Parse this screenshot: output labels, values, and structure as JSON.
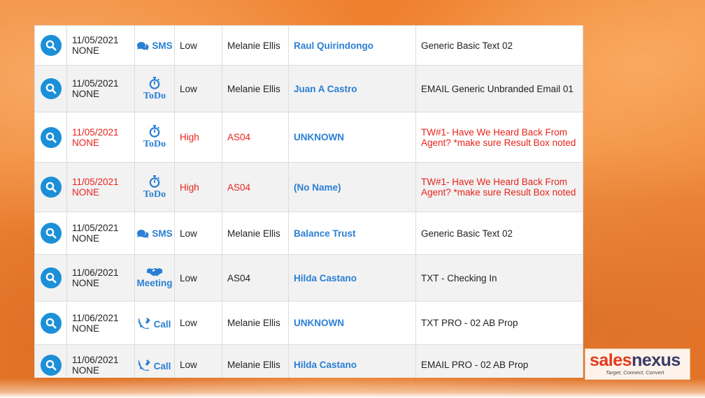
{
  "colors": {
    "accent_blue": "#2a7fd4",
    "button_blue": "#1b8fd8",
    "alert_red": "#e8231c",
    "background_orange": "#ee7f2c"
  },
  "rows": [
    {
      "date": "11/05/2021",
      "time": "NONE",
      "type": "SMS",
      "type_icon": "chat-bubbles-icon",
      "priority": "Low",
      "owner": "Melanie Ellis",
      "contact": "Raul Quirindongo",
      "subject": "Generic Basic Text 02",
      "alert": false
    },
    {
      "date": "11/05/2021",
      "time": "NONE",
      "type": "ToDo",
      "type_icon": "stopwatch-icon",
      "priority": "Low",
      "owner": "Melanie Ellis",
      "contact": "Juan A Castro",
      "subject": "EMAIL Generic Unbranded Email 01",
      "alert": false
    },
    {
      "date": "11/05/2021",
      "time": "NONE",
      "type": "ToDo",
      "type_icon": "stopwatch-icon",
      "priority": "High",
      "owner": "AS04",
      "contact": "UNKNOWN",
      "subject": "TW#1- Have We Heard Back From Agent? *make sure Result Box noted",
      "alert": true
    },
    {
      "date": "11/05/2021",
      "time": "NONE",
      "type": "ToDo",
      "type_icon": "stopwatch-icon",
      "priority": "High",
      "owner": "AS04",
      "contact": "(No Name)",
      "subject": "TW#1- Have We Heard Back From Agent? *make sure Result Box noted",
      "alert": true
    },
    {
      "date": "11/05/2021",
      "time": "NONE",
      "type": "SMS",
      "type_icon": "chat-bubbles-icon",
      "priority": "Low",
      "owner": "Melanie Ellis",
      "contact": "Balance Trust",
      "subject": "Generic Basic Text 02",
      "alert": false
    },
    {
      "date": "11/06/2021",
      "time": "NONE",
      "type": "Meeting",
      "type_icon": "handshake-icon",
      "priority": "Low",
      "owner": "AS04",
      "contact": "Hilda Castano",
      "subject": "TXT - Checking In",
      "alert": false
    },
    {
      "date": "11/06/2021",
      "time": "NONE",
      "type": "Call",
      "type_icon": "phone-icon",
      "priority": "Low",
      "owner": "Melanie Ellis",
      "contact": "UNKNOWN",
      "subject": "TXT PRO - 02 AB Prop",
      "alert": false
    },
    {
      "date": "11/06/2021",
      "time": "NONE",
      "type": "Call",
      "type_icon": "phone-icon",
      "priority": "Low",
      "owner": "Melanie Ellis",
      "contact": "Hilda Castano",
      "subject": "EMAIL PRO - 02 AB Prop",
      "alert": false
    }
  ],
  "logo": {
    "word_sales": "sales",
    "word_nexus": "nexus",
    "tagline": "Target, Connect, Convert"
  }
}
